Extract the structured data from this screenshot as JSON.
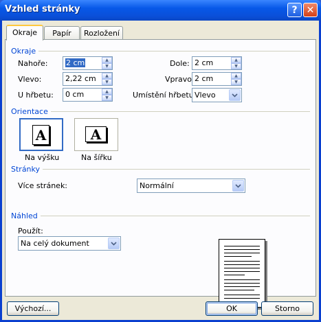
{
  "window": {
    "title": "Vzhled stránky",
    "help_glyph": "?",
    "close_glyph": "✕"
  },
  "tabs": [
    {
      "label": "Okraje",
      "active": true
    },
    {
      "label": "Papír",
      "active": false
    },
    {
      "label": "Rozložení",
      "active": false
    }
  ],
  "margins": {
    "group_label": "Okraje",
    "top_label": "Nahoře:",
    "top_value": "2 cm",
    "bottom_label": "Dole:",
    "bottom_value": "2 cm",
    "left_label": "Vlevo:",
    "left_value": "2,22 cm",
    "right_label": "Vpravo:",
    "right_value": "2 cm",
    "gutter_label": "U hřbetu:",
    "gutter_value": "0 cm",
    "gutter_pos_label": "Umístění hřbetu:",
    "gutter_pos_value": "Vlevo"
  },
  "orientation": {
    "group_label": "Orientace",
    "portrait_label": "Na výšku",
    "landscape_label": "Na šířku",
    "page_letter": "A",
    "selected": "portrait"
  },
  "pages": {
    "group_label": "Stránky",
    "multiple_label": "Více stránek:",
    "multiple_value": "Normální"
  },
  "preview": {
    "group_label": "Náhled",
    "apply_label": "Použít:",
    "apply_value": "Na celý dokument"
  },
  "buttons": {
    "default_label": "Výchozí...",
    "ok_label": "OK",
    "cancel_label": "Storno"
  },
  "colors": {
    "title_bar": "#0a4fd8",
    "group_label": "#0046d5",
    "dialog_bg": "#ece9d8",
    "selection": "#316ac5"
  }
}
